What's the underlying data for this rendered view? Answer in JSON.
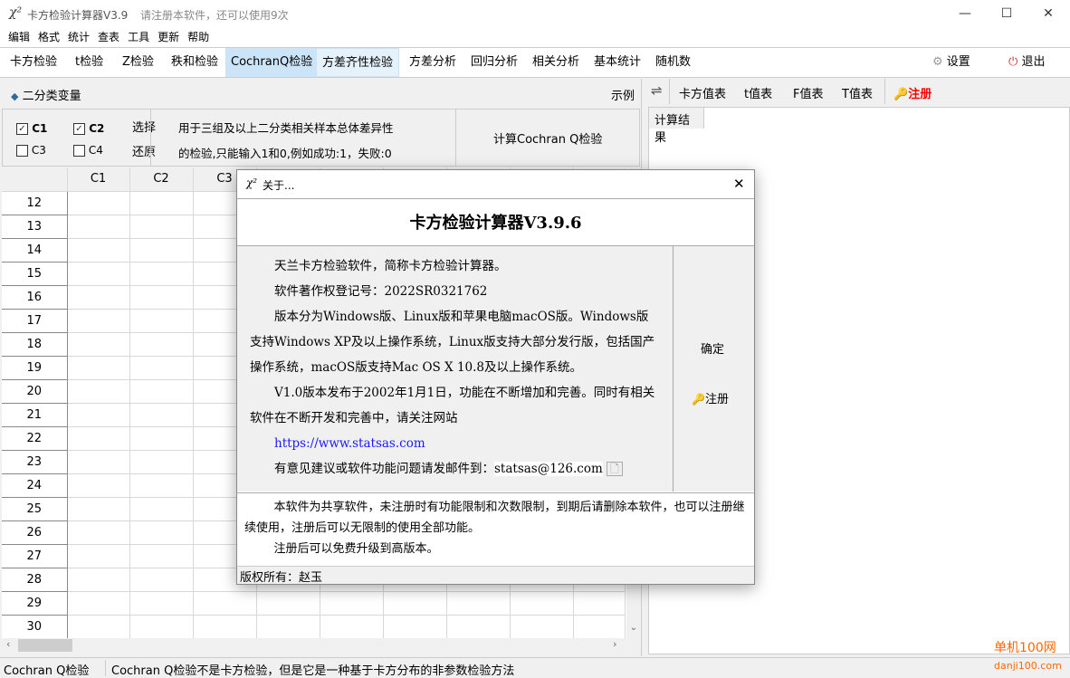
{
  "window": {
    "title": "卡方检验计算器V3.9",
    "subtitle": "请注册本软件，还可以使用9次",
    "minimize": "—",
    "maximize": "☐",
    "close": "✕",
    "logo": "χ²"
  },
  "menu": [
    "编辑",
    "格式",
    "统计",
    "查表",
    "工具",
    "更新",
    "帮助"
  ],
  "toolbar": {
    "tabs": [
      "卡方检验",
      "t检验",
      "Z检验",
      "秩和检验",
      "CochranQ检验",
      "方差齐性检验",
      "方差分析",
      "回归分析",
      "相关分析",
      "基本统计",
      "随机数"
    ],
    "active": "CochranQ检验",
    "settings": "设置",
    "exit": "退出"
  },
  "left": {
    "section_title": "二分类变量",
    "example": "示例",
    "checkboxes": [
      {
        "label": "C1",
        "checked": true
      },
      {
        "label": "C2",
        "checked": true
      },
      {
        "label": "C3",
        "checked": false
      },
      {
        "label": "C4",
        "checked": false
      }
    ],
    "select": "选择",
    "restore": "还原",
    "description_line1": "用于三组及以上二分类相关样本总体差异性",
    "description_line2": "的检验,只能输入1和0,例如成功:1，失败:0",
    "calc_button": "计算Cochran Q检验",
    "grid": {
      "columns": [
        "C1",
        "C2",
        "C3"
      ],
      "rows": [
        "12",
        "13",
        "14",
        "15",
        "16",
        "17",
        "18",
        "19",
        "20",
        "21",
        "22",
        "23",
        "24",
        "25",
        "26",
        "27",
        "28",
        "29",
        "30"
      ]
    }
  },
  "right": {
    "swap": "⇌",
    "tables": [
      "卡方值表",
      "t值表",
      "F值表",
      "T值表"
    ],
    "register": "注册",
    "result_tab": "计算结果"
  },
  "dialog": {
    "title": "关于...",
    "close": "✕",
    "heading": "卡方检验计算器V3.9.6",
    "p1": "天兰卡方检验软件，简称卡方检验计算器。",
    "p2": "软件著作权登记号：2022SR0321762",
    "p3": "版本分为Windows版、Linux版和苹果电脑macOS版。Windows版支持Windows XP及以上操作系统，Linux版支持大部分发行版，包括国产操作系统，macOS版支持Mac OS X 10.8及以上操作系统。",
    "p4": "V1.0版本发布于2002年1月1日，功能在不断增加和完善。同时有相关软件在不断开发和完善中，请关注网站",
    "url": "https://www.statsas.com",
    "email_label": "有意见建议或软件功能问题请发邮件到：",
    "email": "statsas@126.com",
    "ok": "确定",
    "register": "注册",
    "notice1": "本软件为共享软件，未注册时有功能限制和次数限制，到期后请删除本软件，也可以注册继续使用，注册后可以无限制的使用全部功能。",
    "notice2": "注册后可以免费升级到高版本。",
    "copyright": "版权所有：赵玉"
  },
  "status": {
    "left": "Cochran Q检验",
    "message": "Cochran Q检验不是卡方检验，但是它是一种基于卡方分布的非参数检验方法"
  },
  "watermark": {
    "name": "单机100网",
    "url": "danji100.com"
  }
}
